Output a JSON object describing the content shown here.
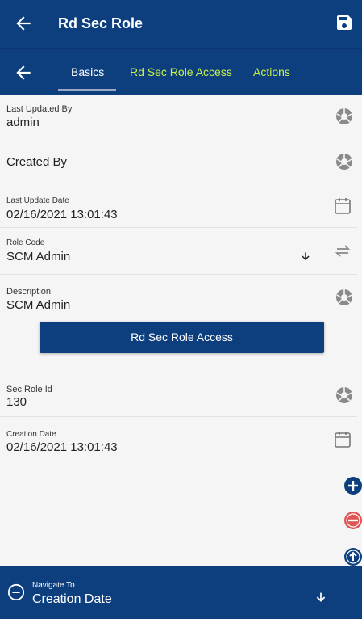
{
  "header": {
    "title": "Rd Sec Role",
    "back_icon": "arrow-left-icon",
    "save_icon": "save-icon"
  },
  "tabs": {
    "back_icon": "arrow-left-icon",
    "items": [
      "Basics",
      "Rd Sec Role Access",
      "Actions"
    ],
    "active": "Basics"
  },
  "fields": {
    "last_updated_by": {
      "label": "Last Updated By",
      "value": "admin",
      "icon": "aperture-icon"
    },
    "created_by": {
      "label": "Created By",
      "icon": "aperture-icon"
    },
    "last_update_date": {
      "label": "Last Update Date",
      "value": "02/16/2021 13:01:43",
      "icon": "calendar-icon"
    },
    "role_code": {
      "label": "Role Code",
      "value": "SCM Admin",
      "icon": "swap-icon",
      "dropdown_icon": "arrow-down-icon"
    },
    "description": {
      "label": "Description",
      "value": "SCM Admin",
      "icon": "aperture-icon"
    },
    "sec_role_id": {
      "label": "Sec Role Id",
      "value": "130",
      "icon": "aperture-icon"
    },
    "creation_date": {
      "label": "Creation Date",
      "value": "02/16/2021 13:01:43",
      "icon": "calendar-icon"
    }
  },
  "access_button": {
    "label": "Rd Sec Role Access"
  },
  "fabs": [
    "plus-circle-icon",
    "minus-circle-icon",
    "upload-circle-icon"
  ],
  "navigate": {
    "label": "Navigate To",
    "value": "Creation Date",
    "icon": "minus-circle-icon",
    "arrow": "arrow-down-icon"
  },
  "colors": {
    "primary": "#0d3f7f",
    "tab_accent": "#c8f04a",
    "danger": "#e05555"
  }
}
